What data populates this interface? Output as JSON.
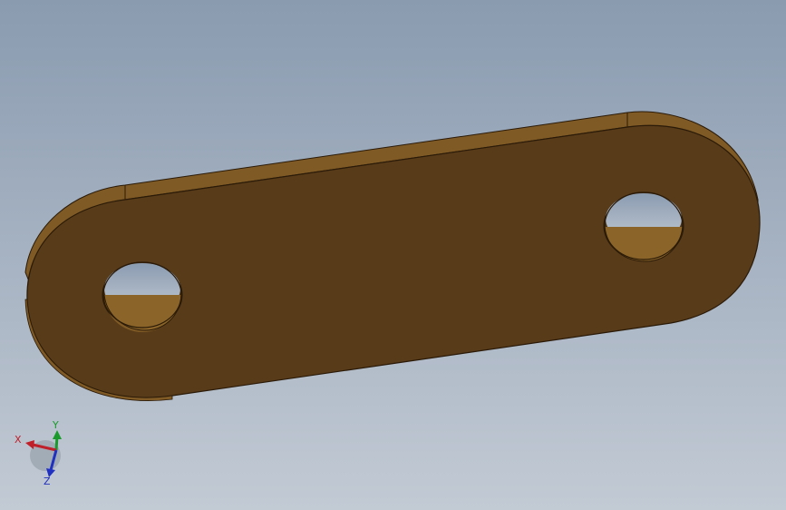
{
  "viewport": {
    "background_top": "#8a9bb0",
    "background_bottom": "#c2cad4"
  },
  "part": {
    "type": "link plate with two holes",
    "face_color": "#583b18",
    "edge_color": "#7f5a25",
    "outline_color": "#2a1a08",
    "hole_count": 2
  },
  "triad": {
    "x_label": "X",
    "y_label": "Y",
    "z_label": "Z",
    "x_color": "#c0202a",
    "y_color": "#1a9a2a",
    "z_color": "#2030c0"
  }
}
